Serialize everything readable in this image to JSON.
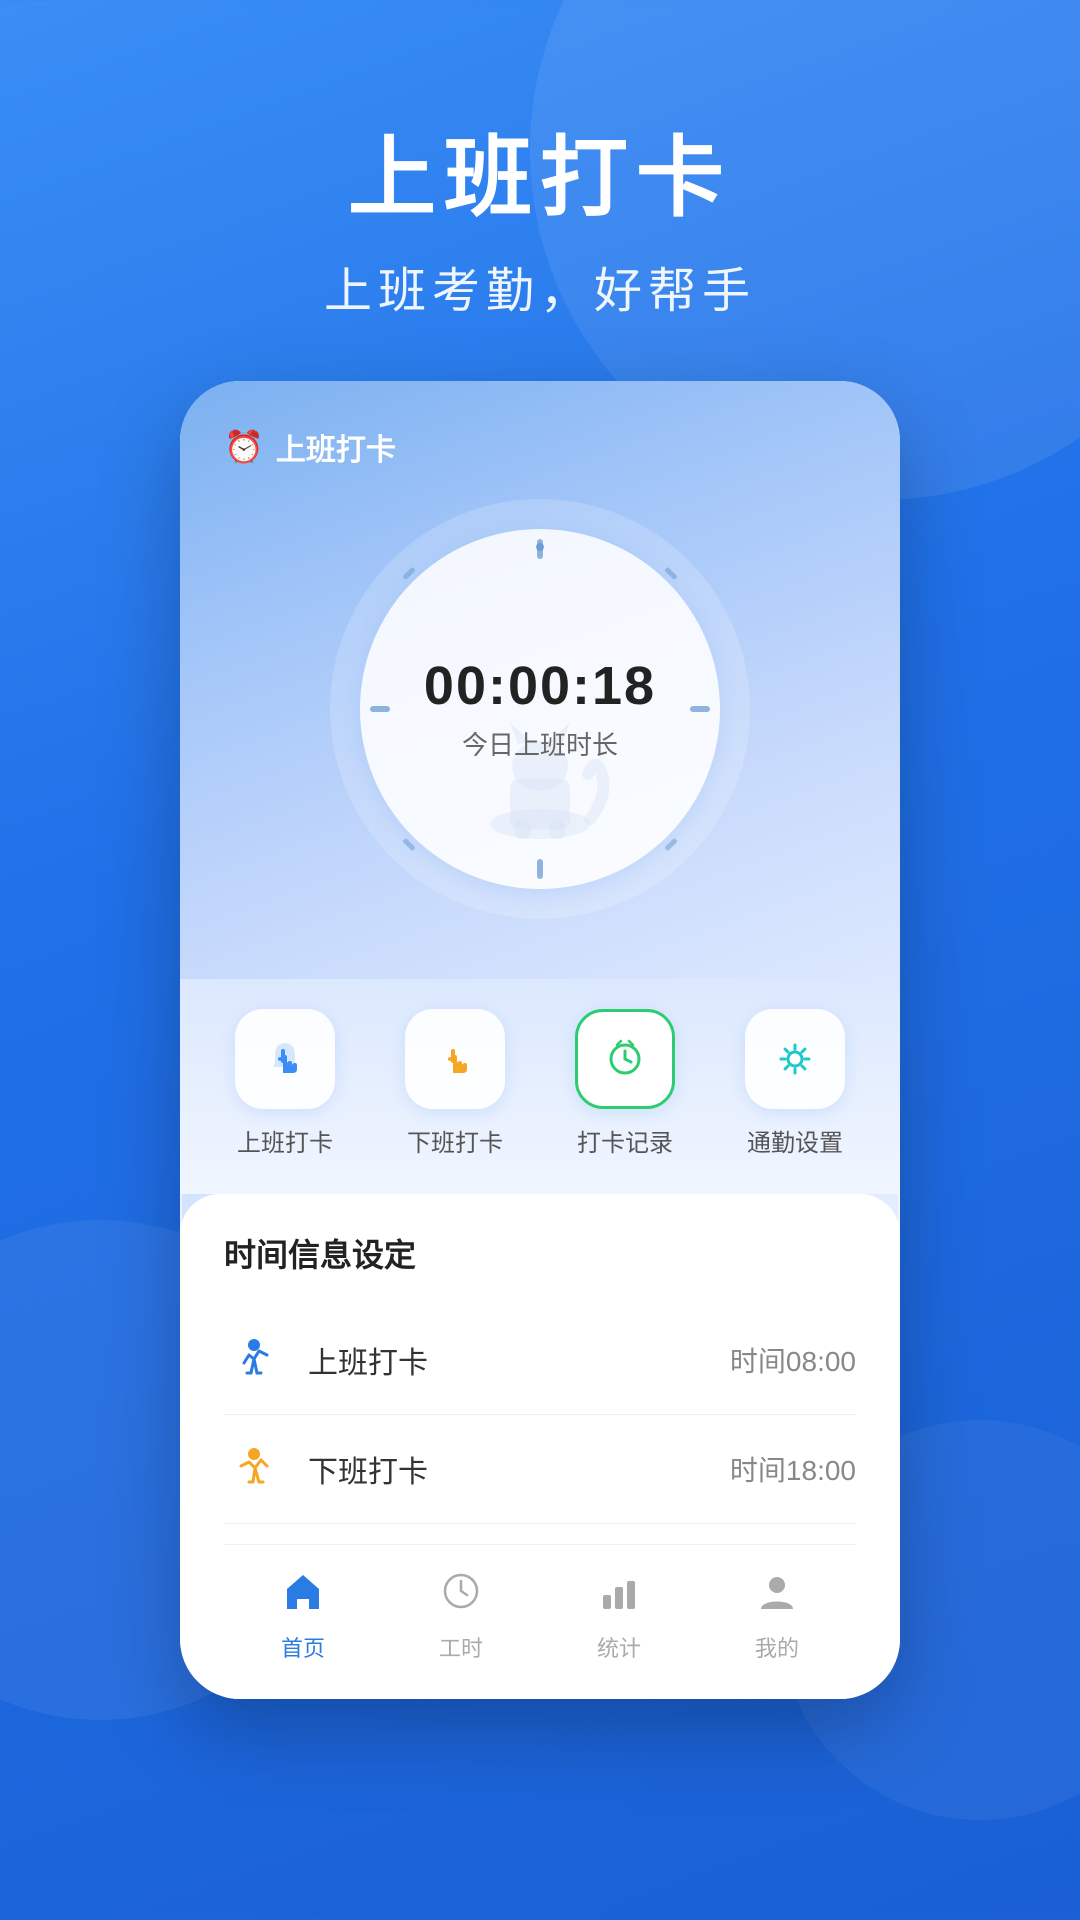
{
  "app": {
    "title_main": "上班打卡",
    "title_sub": "上班考勤，好帮手",
    "bar_icon": "🕐",
    "bar_title": "上班打卡"
  },
  "clock": {
    "time": "00:00:18",
    "label": "今日上班时长"
  },
  "action_buttons": [
    {
      "id": "checkin",
      "icon": "👆",
      "label": "上班打卡",
      "icon_color": "#2a7be4"
    },
    {
      "id": "checkout",
      "icon": "👆",
      "label": "下班打卡",
      "icon_color": "#f5a623"
    },
    {
      "id": "records",
      "icon": "🕐",
      "label": "打卡记录",
      "icon_color": "#2ecc71"
    },
    {
      "id": "settings",
      "icon": "⚙️",
      "label": "通勤设置",
      "icon_color": "#1bc9c9"
    }
  ],
  "section_title": "时间信息设定",
  "schedule": [
    {
      "id": "work_start",
      "name": "上班打卡",
      "time": "时间08:00",
      "icon_color": "#2a7be4"
    },
    {
      "id": "work_end",
      "name": "下班打卡",
      "time": "时间18:00",
      "icon_color": "#f5a623"
    }
  ],
  "bottom_nav": [
    {
      "id": "home",
      "icon": "🏠",
      "label": "首页",
      "active": true
    },
    {
      "id": "hours",
      "icon": "🕐",
      "label": "工时",
      "active": false
    },
    {
      "id": "stats",
      "icon": "📊",
      "label": "统计",
      "active": false
    },
    {
      "id": "profile",
      "icon": "👤",
      "label": "我的",
      "active": false
    }
  ],
  "colors": {
    "bg_start": "#3a8ef5",
    "bg_end": "#1a5fd4",
    "accent_blue": "#2a7be4",
    "accent_orange": "#f5a623",
    "accent_green": "#2ecc71",
    "accent_teal": "#1bc9c9"
  }
}
